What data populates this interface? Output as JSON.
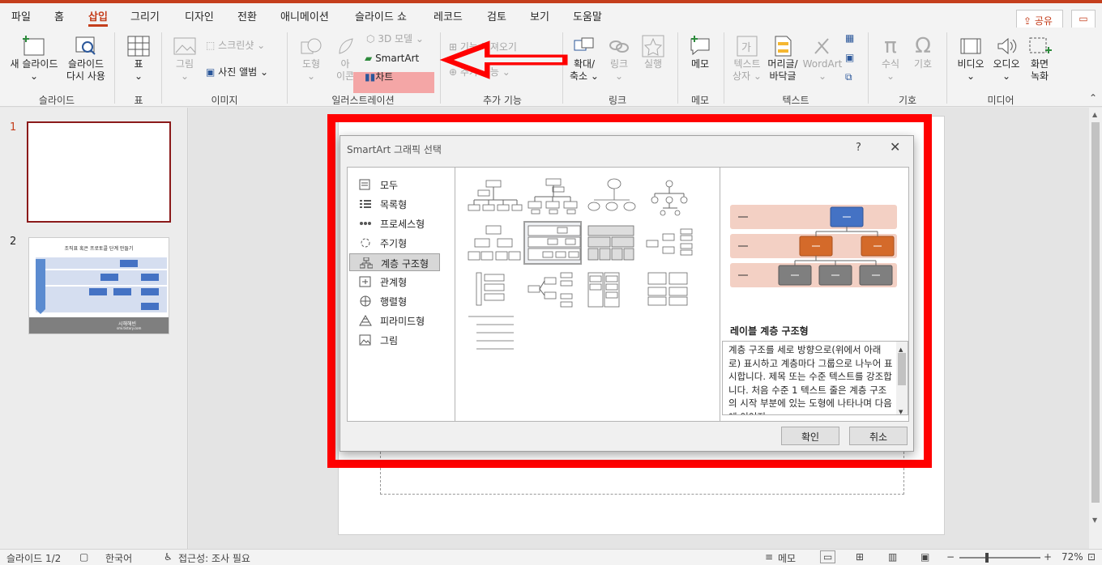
{
  "tabs": [
    "파일",
    "홈",
    "삽입",
    "그리기",
    "디자인",
    "전환",
    "애니메이션",
    "슬라이드 쇼",
    "레코드",
    "검토",
    "보기",
    "도움말"
  ],
  "active_tab": "삽입",
  "share_label": "공유",
  "ribbon": {
    "new_slide": "새 슬라이드",
    "reuse_slide_1": "슬라이드",
    "reuse_slide_2": "다시 사용",
    "table": "표",
    "image": "그림",
    "screenshot": "스크린샷",
    "photo_album": "사진 앨범",
    "shapes": "도형",
    "icons_1": "아",
    "icons_2": "이콘",
    "model3d": "3D 모델",
    "smartart": "SmartArt",
    "chart": "차트",
    "get_addins": "기능 가져오기",
    "my_addins": "추가 기능",
    "zoom_1": "확대/",
    "zoom_2": "축소",
    "link": "링크",
    "action": "실행",
    "comment": "메모",
    "textbox_1": "텍스트",
    "textbox_2": "상자",
    "header_1": "머리글/",
    "header_2": "바닥글",
    "wordart": "WordArt",
    "equation": "수식",
    "symbol": "기호",
    "video": "비디오",
    "audio": "오디오",
    "screen_rec_1": "화면",
    "screen_rec_2": "녹화",
    "groups": {
      "slides": "슬라이드",
      "table": "표",
      "images": "이미지",
      "illustrations": "일러스트레이션",
      "addins": "추가 기능",
      "links": "링크",
      "comments": "메모",
      "text": "텍스트",
      "symbols": "기호",
      "media": "미디어"
    }
  },
  "slides": {
    "n1": "1",
    "n2": "2",
    "thumb2_title": "조직표 혹은 프로토콜 단계 만들기",
    "thumb2_footer": "시해해빈",
    "thumb2_url": "smi.tistory.com"
  },
  "dialog": {
    "title": "SmartArt 그래픽 선택",
    "help": "?",
    "close": "✕",
    "categories": [
      "모두",
      "목록형",
      "프로세스형",
      "주기형",
      "계층 구조형",
      "관계형",
      "행렬형",
      "피라미드형",
      "그림"
    ],
    "selected_category": "계층 구조형",
    "preview_title": "레이블 계층 구조형",
    "preview_desc": "계층 구조를 세로 방향으로(위에서 아래로) 표시하고 계층마다 그룹으로 나누어 표시합니다. 제목 또는 수준 텍스트를 강조합니다. 처음 수준 1 텍스트 줄은 계층 구조의 시작 부분에 있는 도형에 나타나며 다음에 이어지",
    "ok": "확인",
    "cancel": "취소"
  },
  "status": {
    "slide": "슬라이드 1/2",
    "lang": "한국어",
    "access": "접근성: 조사 필요",
    "notes": "메모",
    "zoom": "72%"
  }
}
